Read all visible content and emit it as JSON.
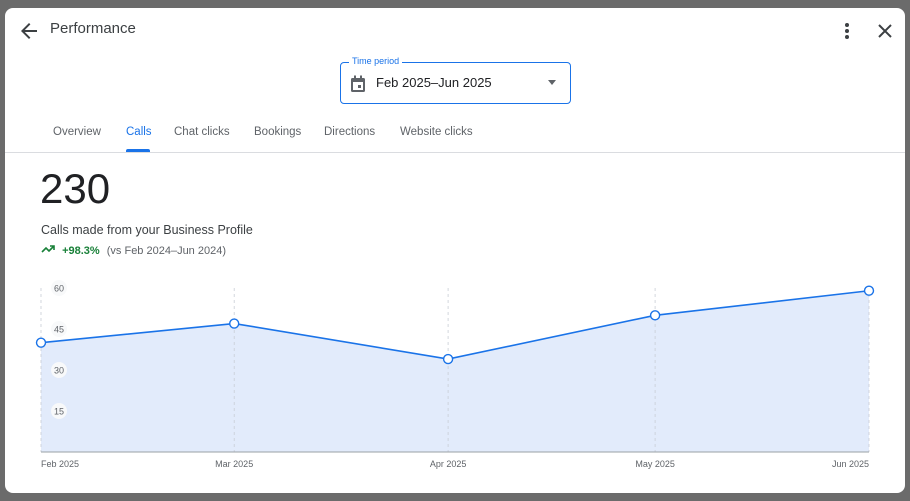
{
  "header": {
    "title": "Performance",
    "back_icon": "arrow-back-icon",
    "more_icon": "more-vert-icon",
    "close_icon": "close-icon"
  },
  "time_period": {
    "label": "Time period",
    "value": "Feb 2025–Jun 2025",
    "icon": "calendar-icon"
  },
  "tabs": [
    {
      "label": "Overview"
    },
    {
      "label": "Calls",
      "active": true
    },
    {
      "label": "Chat clicks"
    },
    {
      "label": "Bookings"
    },
    {
      "label": "Directions"
    },
    {
      "label": "Website clicks"
    }
  ],
  "metric": {
    "value": "230",
    "description": "Calls made from your Business Profile",
    "change": "+98.3%",
    "comparison": "(vs Feb 2024–Jun 2024)",
    "trend_color": "#188038"
  },
  "chart_data": {
    "type": "area",
    "categories": [
      "Feb 2025",
      "Mar 2025",
      "Apr 2025",
      "May 2025",
      "Jun 2025"
    ],
    "values": [
      40,
      47,
      34,
      50,
      59
    ],
    "yticks": [
      "60",
      "45",
      "30",
      "15"
    ],
    "ylim": [
      0,
      60
    ],
    "grid": "vertical dashed",
    "line_color": "#1a73e8",
    "fill_color": "#e2ebfb"
  }
}
